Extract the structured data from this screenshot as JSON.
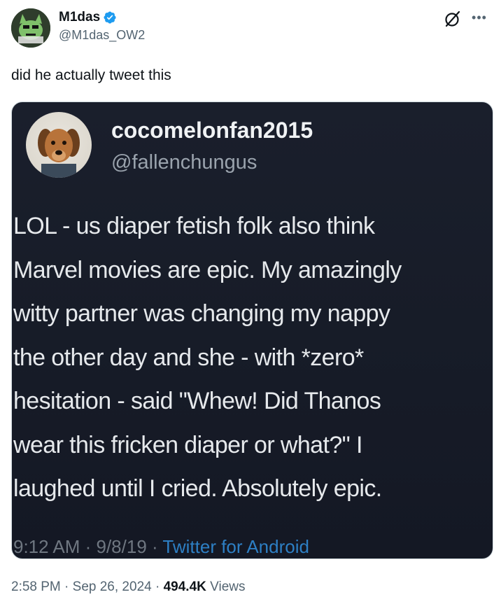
{
  "author": {
    "name": "M1das",
    "handle": "@M1das_OW2"
  },
  "tweet": {
    "text": "did he actually tweet this",
    "time": "2:58 PM",
    "sep1": " · ",
    "date": "Sep 26, 2024",
    "sep2": " · ",
    "views_count": "494.4K",
    "views_label": " Views"
  },
  "embedded": {
    "name": "cocomelonfan2015",
    "handle": "@fallenchungus",
    "body": "LOL - us diaper fetish folk also think\nMarvel movies are epic. My amazingly\nwitty partner was changing my nappy\nthe other day and she - with *zero*\nhesitation - said \"Whew! Did Thanos\nwear this fricken diaper or what?\" I\nlaughed until I cried. Absolutely epic.",
    "meta_time": "9:12 AM · 9/8/19 · ",
    "meta_source": "Twitter for Android"
  },
  "icons": {
    "verified": "verified-badge-icon",
    "grok": "grok-icon",
    "more": "more-icon"
  },
  "colors": {
    "verified": "#1d9bf0",
    "secondary_text": "#536471",
    "embedded_bg": "#181d29",
    "embedded_link": "#2d7fc4"
  }
}
